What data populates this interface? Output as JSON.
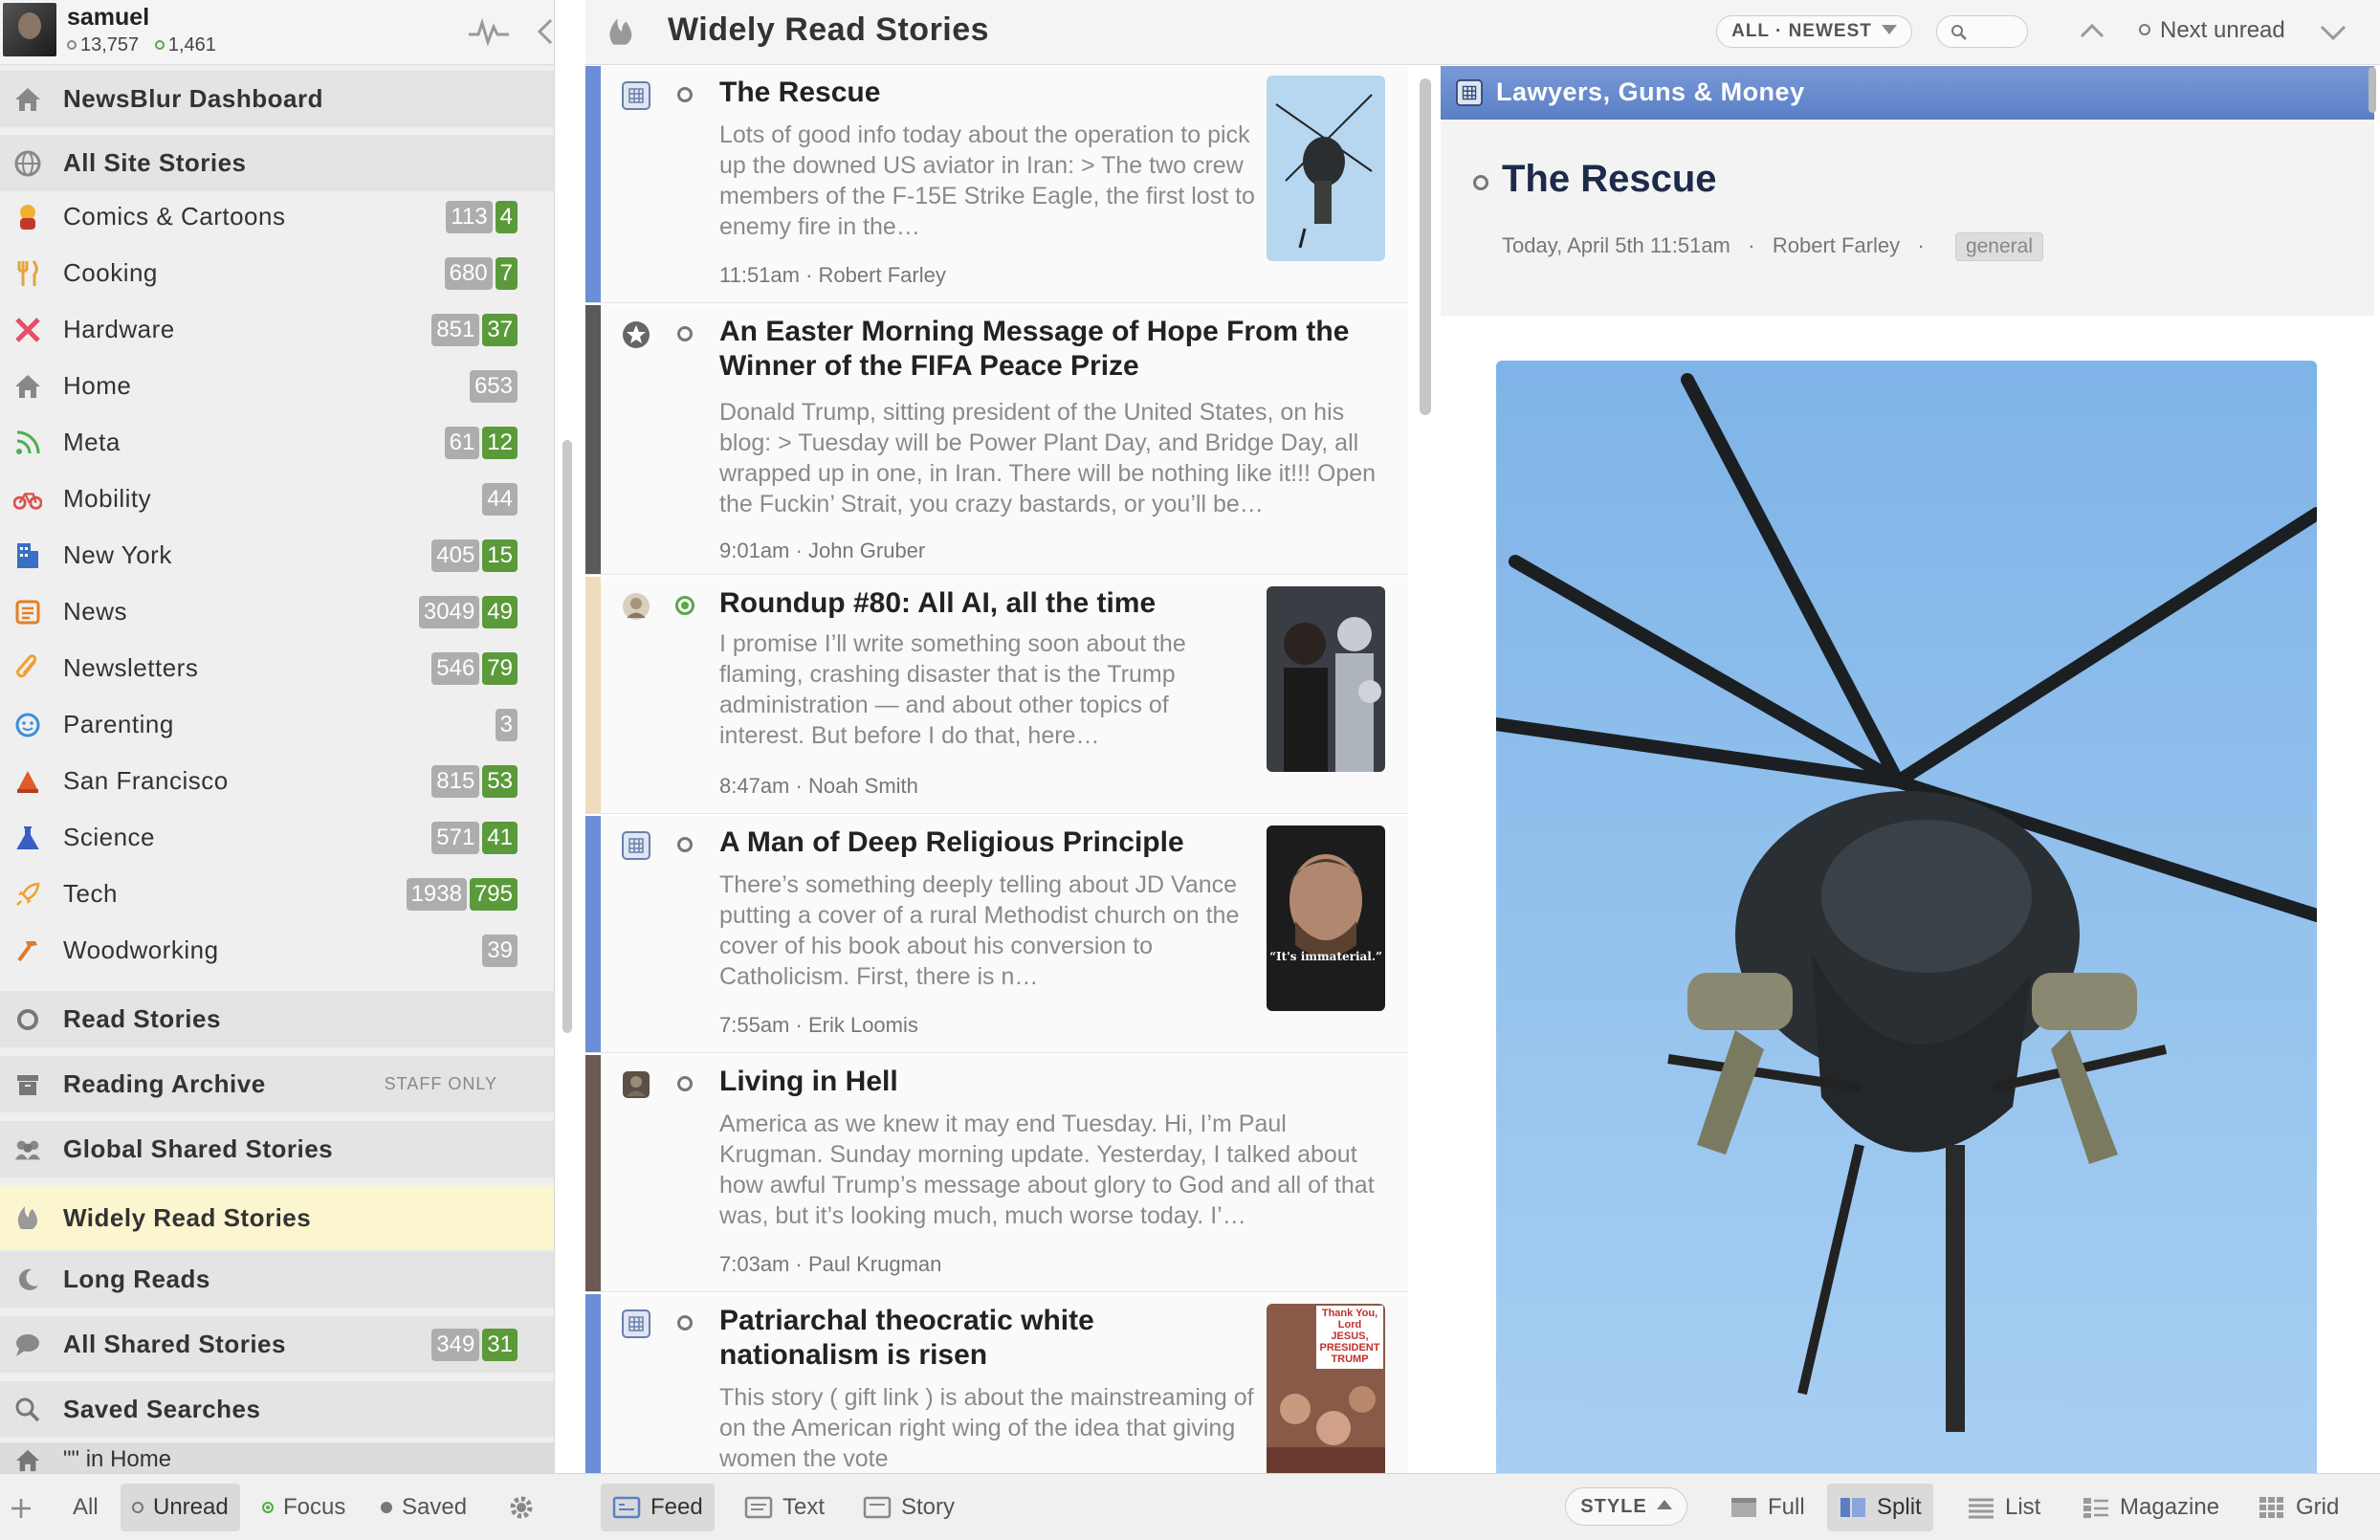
{
  "user": {
    "name": "samuel",
    "stat_unread": "13,757",
    "stat_focus": "1,461"
  },
  "sidebar": {
    "top": [
      {
        "label": "NewsBlur Dashboard",
        "icon": "house-icon"
      },
      {
        "label": "All Site Stories",
        "icon": "globe-icon"
      }
    ],
    "folders": [
      {
        "label": "Comics & Cartoons",
        "icon": "comic-icon",
        "unread": "113",
        "focus": "4",
        "color": "#c0392b"
      },
      {
        "label": "Cooking",
        "icon": "utensils-icon",
        "unread": "680",
        "focus": "7",
        "color": "#e6a23c"
      },
      {
        "label": "Hardware",
        "icon": "tools-icon",
        "unread": "851",
        "focus": "37",
        "color": "#e74c6b"
      },
      {
        "label": "Home",
        "icon": "house-icon",
        "unread": "653",
        "focus": "",
        "color": "#888888"
      },
      {
        "label": "Meta",
        "icon": "rss-icon",
        "unread": "61",
        "focus": "12",
        "color": "#4caf50"
      },
      {
        "label": "Mobility",
        "icon": "bicycle-icon",
        "unread": "44",
        "focus": "",
        "color": "#d9534f"
      },
      {
        "label": "New York",
        "icon": "building-icon",
        "unread": "405",
        "focus": "15",
        "color": "#3a6fc4"
      },
      {
        "label": "News",
        "icon": "newspaper-icon",
        "unread": "3049",
        "focus": "49",
        "color": "#e67e22"
      },
      {
        "label": "Newsletters",
        "icon": "paperclip-icon",
        "unread": "546",
        "focus": "79",
        "color": "#f0a030"
      },
      {
        "label": "Parenting",
        "icon": "baby-icon",
        "unread": "3",
        "focus": "",
        "color": "#3a8fd8"
      },
      {
        "label": "San Francisco",
        "icon": "cable-car-icon",
        "unread": "815",
        "focus": "53",
        "color": "#e05a2a"
      },
      {
        "label": "Science",
        "icon": "flask-icon",
        "unread": "571",
        "focus": "41",
        "color": "#3a5fc4"
      },
      {
        "label": "Tech",
        "icon": "rocket-icon",
        "unread": "1938",
        "focus": "795",
        "color": "#f0a030"
      },
      {
        "label": "Woodworking",
        "icon": "hammer-icon",
        "unread": "39",
        "focus": "",
        "color": "#e07a2a"
      }
    ],
    "specials": [
      {
        "label": "Read Stories",
        "icon": "circle-icon",
        "unread": "",
        "focus": ""
      },
      {
        "label": "Reading Archive",
        "icon": "archive-icon",
        "staff": "STAFF ONLY"
      },
      {
        "label": "Global Shared Stories",
        "icon": "people-icon"
      },
      {
        "label": "Widely Read Stories",
        "icon": "flame-icon"
      },
      {
        "label": "Long Reads",
        "icon": "moon-icon"
      },
      {
        "label": "All Shared Stories",
        "icon": "chat-icon",
        "unread": "349",
        "focus": "31"
      },
      {
        "label": "Saved Searches",
        "icon": "search-icon"
      }
    ],
    "saved_search": {
      "query": "\"\"",
      "in": "in",
      "folder": "Home"
    }
  },
  "header": {
    "title": "Widely Read Stories",
    "order": "ALL · NEWEST",
    "next_unread": "Next unread"
  },
  "stories": [
    {
      "title": "The Rescue",
      "body": "Lots of good info today about the operation to pick up the downed US aviator in Iran: > The two crew members of the F-15E Strike Eagle, the first lost to enemy fire in the…",
      "time": "11:51am",
      "author": "Robert Farley",
      "bar": "#6b8ed6",
      "read": "unread"
    },
    {
      "title": "An Easter Morning Message of Hope From the Winner of the FIFA Peace Prize",
      "body": "Donald Trump, sitting president of the United States, on his blog: > Tuesday will be Power Plant Day, and Bridge Day, all wrapped up in one, in Iran. There will be nothing like it!!! Open the Fuckin’ Strait, you crazy bastards, or you’ll be…",
      "time": "9:01am",
      "author": "John Gruber",
      "bar": "#5a5a5a",
      "read": "unread"
    },
    {
      "title": "Roundup #80: All AI, all the time",
      "body": "I promise I’ll write something soon about the flaming, crashing disaster that is the Trump administration — and about other topics of interest. But before I do that, here…",
      "time": "8:47am",
      "author": "Noah Smith",
      "bar": "#f0dcbc",
      "read": "focus"
    },
    {
      "title": "A Man of Deep Religious Principle",
      "body": "There’s something deeply telling about JD Vance putting a cover of a rural Methodist church on the cover of his book about his conversion to Catholicism. First, there is n…",
      "time": "7:55am",
      "author": "Erik Loomis",
      "bar": "#6b8ed6",
      "read": "unread",
      "thumb_caption": "“It's immaterial.”"
    },
    {
      "title": "Living in Hell",
      "body": "America as we knew it may end Tuesday. Hi, I’m Paul Krugman. Sunday morning update. Yesterday, I talked about how awful Trump’s message about glory to God and all of that was, but it’s looking much, much worse today. I’…",
      "time": "7:03am",
      "author": "Paul Krugman",
      "bar": "#6b5a50",
      "read": "unread"
    },
    {
      "title": "Patriarchal theocratic white nationalism is risen",
      "body": "This story ( gift link ) is about the mainstreaming of on the American right wing of the idea that giving women the vote",
      "time": "",
      "author": "",
      "bar": "#6b8ed6",
      "read": "unread",
      "thumb_caption": "Thank You, Lord JESUS, PRESIDENT TRUMP"
    }
  ],
  "detail": {
    "feed_name": "Lawyers, Guns & Money",
    "title": "The Rescue",
    "date": "Today, April 5th 11:51am",
    "author": "Robert Farley",
    "tag": "general"
  },
  "footer": {
    "filters": [
      "All",
      "Unread",
      "Focus",
      "Saved"
    ],
    "views": [
      "Feed",
      "Text",
      "Story"
    ],
    "style": "STYLE",
    "layouts": [
      "Full",
      "Split",
      "List",
      "Magazine",
      "Grid"
    ]
  },
  "colors": {
    "accent_blue": "#5a7fc7",
    "focus_green": "#5a9a3a",
    "active_row": "#fbf6cf"
  }
}
